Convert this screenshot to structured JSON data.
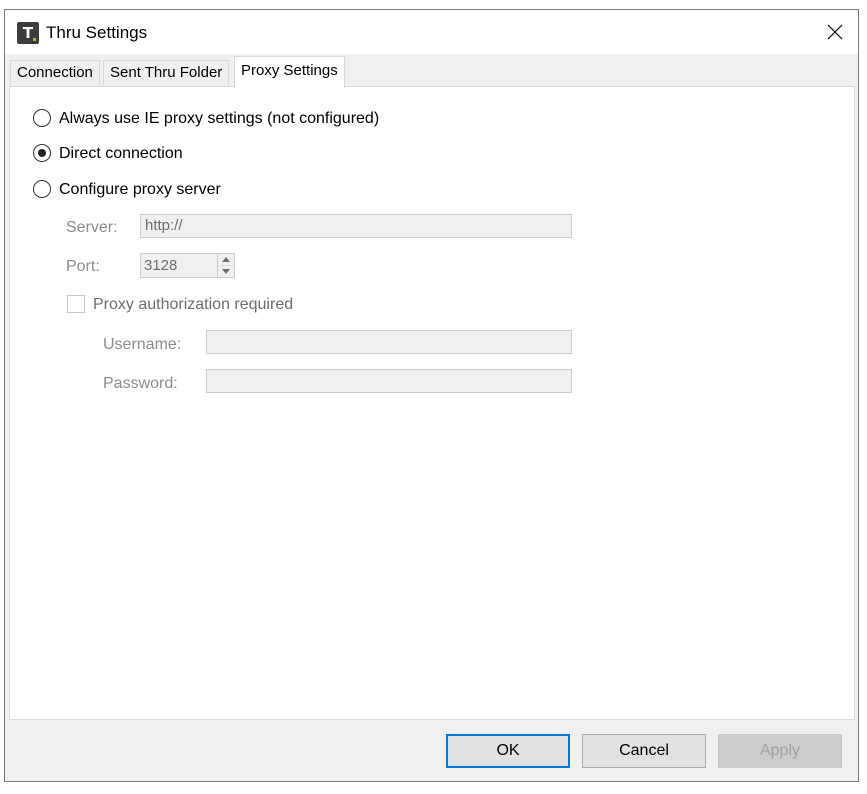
{
  "window": {
    "title": "Thru Settings",
    "icon_letter": "T"
  },
  "tabs": [
    {
      "label": "Connection",
      "active": false
    },
    {
      "label": "Sent Thru Folder",
      "active": false
    },
    {
      "label": "Proxy Settings",
      "active": true
    }
  ],
  "proxy": {
    "options": [
      {
        "label": "Always use IE proxy settings (not configured)",
        "checked": false
      },
      {
        "label": "Direct connection",
        "checked": true
      },
      {
        "label": "Configure proxy server",
        "checked": false
      }
    ],
    "server_label": "Server:",
    "server_value": "http://",
    "port_label": "Port:",
    "port_value": "3128",
    "auth_label": "Proxy authorization required",
    "auth_checked": false,
    "username_label": "Username:",
    "username_value": "",
    "password_label": "Password:",
    "password_value": ""
  },
  "buttons": {
    "ok": "OK",
    "cancel": "Cancel",
    "apply": "Apply"
  }
}
